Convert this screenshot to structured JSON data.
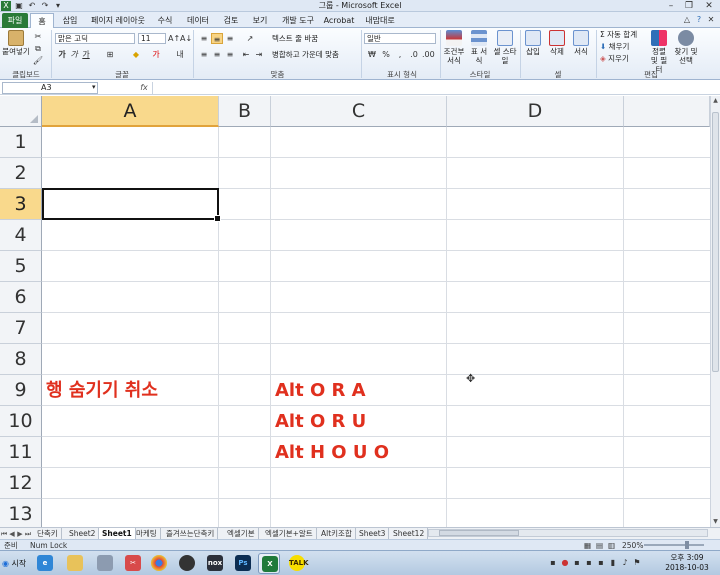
{
  "window": {
    "title": "그룹 - Microsoft Excel"
  },
  "ribbon": {
    "tabs": [
      "파일",
      "홈",
      "삽입",
      "페이지 레이아웃",
      "수식",
      "데이터",
      "검토",
      "보기",
      "개발 도구",
      "Acrobat",
      "내맘대로"
    ],
    "clipboard": {
      "paste": "붙여넣기",
      "label": "클립보드"
    },
    "font": {
      "name": "맑은 고딕",
      "size": "11",
      "label": "글꼴"
    },
    "alignment": {
      "wrap_text": "텍스트 줄 바꿈",
      "merge_center": "병합하고 가운데 맞춤",
      "label": "맞춤"
    },
    "number": {
      "format": "일반",
      "label": "표시 형식"
    },
    "styles": {
      "conditional": "조건부 서식",
      "table": "표 서식",
      "cell_style": "셀 스타일",
      "label": "스타일"
    },
    "cells": {
      "insert": "삽입",
      "delete": "삭제",
      "format": "서식",
      "label": "셀"
    },
    "editing": {
      "autosum": "자동 합계",
      "fill": "채우기",
      "clear": "지우기",
      "sort_filter": "정렬 및 필터",
      "find_select": "찾기 및 선택",
      "label": "편집"
    }
  },
  "formula_bar": {
    "name_box": "A3",
    "fx": "fx",
    "content": ""
  },
  "grid": {
    "columns": [
      "A",
      "B",
      "C",
      "D"
    ],
    "selected_column": "A",
    "rows": [
      "1",
      "2",
      "3",
      "4",
      "5",
      "6",
      "7",
      "8",
      "9",
      "10",
      "11",
      "12",
      "13"
    ],
    "selected_row": "3",
    "cells": {
      "A9": "행 숨기기 취소",
      "C9": "Alt O R A",
      "C10": "Alt O R U",
      "C11": "Alt H O U O"
    },
    "text_color": "#e0301e"
  },
  "sheets": {
    "tabs": [
      "단축키",
      "Sheet2",
      "Sheet1",
      "마케팅",
      "즐겨쓰는단축키",
      "엑셀기본",
      "엑셀기본+알트",
      "Alt키조합",
      "Sheet3",
      "Sheet12"
    ],
    "active": "Sheet1"
  },
  "status": {
    "ready": "준비",
    "num_lock": "Num Lock",
    "zoom": "250%"
  },
  "taskbar": {
    "start": "시작",
    "time": "오후 3:09",
    "date": "2018-10-03"
  }
}
